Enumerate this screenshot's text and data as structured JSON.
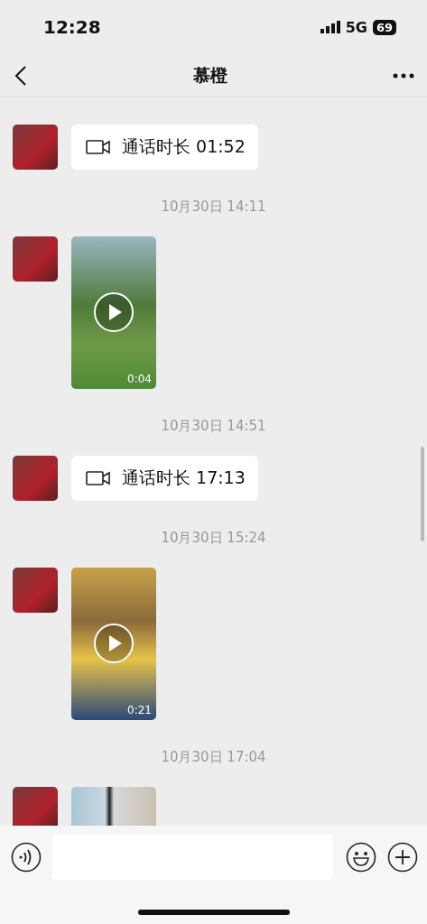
{
  "status_bar": {
    "time": "12:28",
    "network": "5G",
    "battery": "69"
  },
  "header": {
    "title": "慕橙"
  },
  "messages": [
    {
      "kind": "call",
      "duration": "通话时长 01:52"
    },
    {
      "kind": "timestamp",
      "text": "10月30日 14:11"
    },
    {
      "kind": "video",
      "duration": "0:04"
    },
    {
      "kind": "timestamp",
      "text": "10月30日 14:51"
    },
    {
      "kind": "call",
      "duration": "通话时长 17:13"
    },
    {
      "kind": "timestamp",
      "text": "10月30日 15:24"
    },
    {
      "kind": "video",
      "duration": "0:21"
    },
    {
      "kind": "timestamp",
      "text": "10月30日 17:04"
    },
    {
      "kind": "image"
    }
  ]
}
